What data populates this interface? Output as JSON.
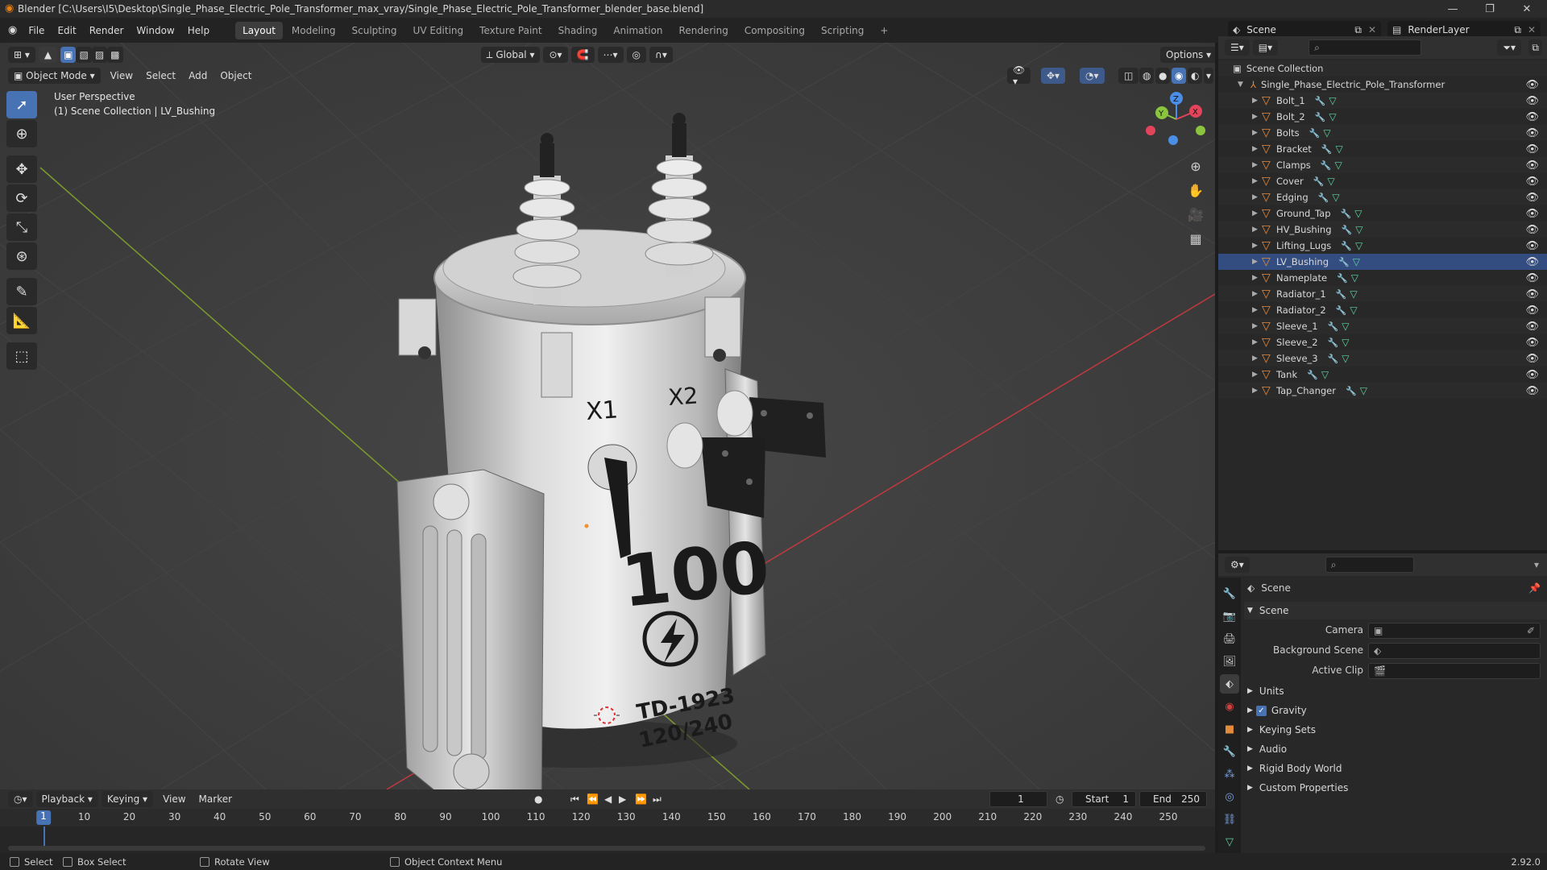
{
  "titlebar": {
    "title": "Blender [C:\\Users\\I5\\Desktop\\Single_Phase_Electric_Pole_Transformer_max_vray/Single_Phase_Electric_Pole_Transformer_blender_base.blend]"
  },
  "menus": [
    "File",
    "Edit",
    "Render",
    "Window",
    "Help"
  ],
  "workspaces": [
    "Layout",
    "Modeling",
    "Sculpting",
    "UV Editing",
    "Texture Paint",
    "Shading",
    "Animation",
    "Rendering",
    "Compositing",
    "Scripting"
  ],
  "active_workspace": "Layout",
  "scene_selector": "Scene",
  "renderlayer_selector": "RenderLayer",
  "viewport": {
    "mode": "Object Mode",
    "menus": [
      "View",
      "Select",
      "Add",
      "Object"
    ],
    "transform_orientation": "Global",
    "options_label": "Options",
    "info_line1": "User Perspective",
    "info_line2": "(1) Scene Collection | LV_Bushing",
    "model_text": {
      "x1": "X1",
      "x2": "X2",
      "kva": "100",
      "model": "TD-1923",
      "voltage": "120/240"
    }
  },
  "outliner": {
    "root": "Scene Collection",
    "collection": "Single_Phase_Electric_Pole_Transformer",
    "objects": [
      "Bolt_1",
      "Bolt_2",
      "Bolts",
      "Bracket",
      "Clamps",
      "Cover",
      "Edging",
      "Ground_Tap",
      "HV_Bushing",
      "Lifting_Lugs",
      "LV_Bushing",
      "Nameplate",
      "Radiator_1",
      "Radiator_2",
      "Sleeve_1",
      "Sleeve_2",
      "Sleeve_3",
      "Tank",
      "Tap_Changer"
    ],
    "active_object": "LV_Bushing"
  },
  "properties": {
    "context": "Scene",
    "panel": "Scene",
    "camera_label": "Camera",
    "background_scene_label": "Background Scene",
    "active_clip_label": "Active Clip",
    "sections": [
      "Units",
      "Gravity",
      "Keying Sets",
      "Audio",
      "Rigid Body World",
      "Custom Properties"
    ],
    "gravity_enabled": true
  },
  "timeline": {
    "menus": [
      "Playback",
      "Keying",
      "View",
      "Marker"
    ],
    "current_frame": "1",
    "start_label": "Start",
    "start_value": "1",
    "end_label": "End",
    "end_value": "250",
    "ticks": [
      "1",
      "10",
      "20",
      "30",
      "40",
      "50",
      "60",
      "70",
      "80",
      "90",
      "100",
      "110",
      "120",
      "130",
      "140",
      "150",
      "160",
      "170",
      "180",
      "190",
      "200",
      "210",
      "220",
      "230",
      "240",
      "250"
    ]
  },
  "statusbar": {
    "select": "Select",
    "box_select": "Box Select",
    "rotate_view": "Rotate View",
    "context_menu": "Object Context Menu",
    "version": "2.92.0"
  },
  "colors": {
    "accent": "#4772b3",
    "object_icon": "#e38b3a",
    "x_axis": "#e2445b",
    "y_axis": "#8bc43f",
    "z_axis": "#4a8ee6"
  }
}
